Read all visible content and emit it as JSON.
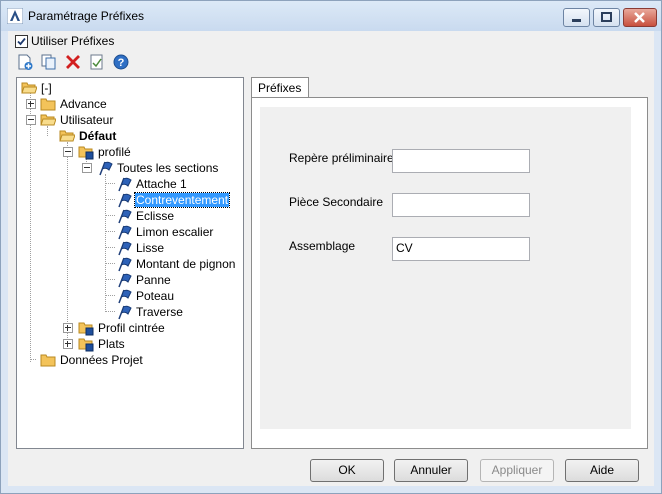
{
  "window": {
    "title": "Paramétrage Préfixes"
  },
  "toolbar": {
    "use_prefixes_label": "Utiliser Préfixes",
    "use_prefixes_checked": true,
    "buttons": [
      "new-icon",
      "copy-icon",
      "delete-icon",
      "properties-icon",
      "help-icon"
    ]
  },
  "tree": {
    "root": "[-]",
    "advance": "Advance",
    "utilisateur": "Utilisateur",
    "defaut": "Défaut",
    "profile": "profilé",
    "toutes": "Toutes les sections",
    "sections": [
      "Attache 1",
      "Contreventement",
      "Eclisse",
      "Limon escalier",
      "Lisse",
      "Montant de pignon",
      "Panne",
      "Poteau",
      "Traverse"
    ],
    "selected": "Contreventement",
    "profil_cintree": "Profil cintrée",
    "plats": "Plats",
    "donnees_projet": "Données Projet"
  },
  "tab": {
    "label": "Préfixes"
  },
  "form": {
    "repere_label": "Repère préliminaire",
    "repere_value": "",
    "piece_label": "Pièce Secondaire",
    "piece_value": "",
    "assemblage_label": "Assemblage",
    "assemblage_value": "CV"
  },
  "buttons": {
    "ok": "OK",
    "annuler": "Annuler",
    "appliquer": "Appliquer",
    "aide": "Aide"
  },
  "colors": {
    "selection": "#3399ff",
    "delete_icon": "#d21f1f",
    "folder": "#f3c35a"
  }
}
